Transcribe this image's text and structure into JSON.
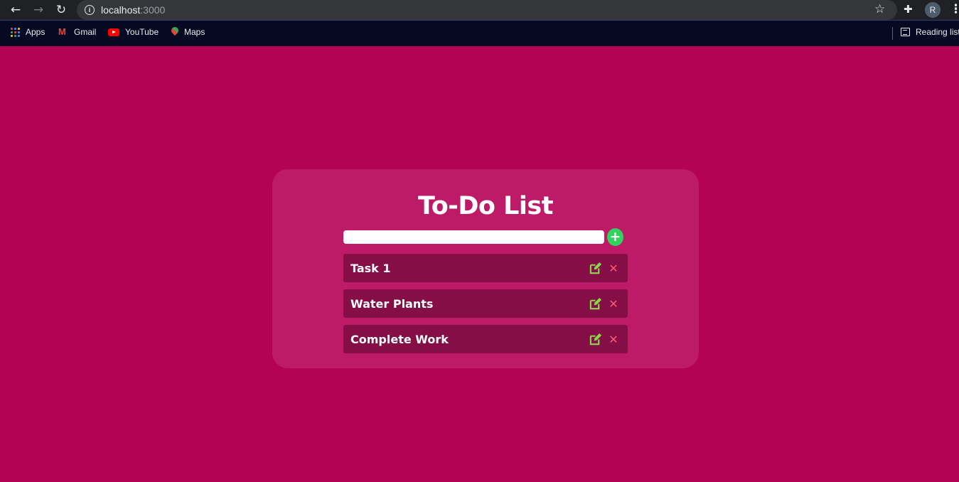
{
  "browser": {
    "back_icon": "arrow-left-icon",
    "forward_icon": "arrow-right-icon",
    "reload_icon": "reload-icon",
    "url_host": "localhost",
    "url_port": ":3000",
    "avatar_letter": "R"
  },
  "bookmarks": [
    {
      "label": "Apps",
      "icon": "apps-grid-icon"
    },
    {
      "label": "Gmail",
      "icon": "gmail-icon"
    },
    {
      "label": "YouTube",
      "icon": "youtube-icon"
    },
    {
      "label": "Maps",
      "icon": "maps-icon"
    }
  ],
  "reading_list": {
    "label": "Reading list",
    "icon": "reading-list-icon"
  },
  "app": {
    "title": "To-Do List",
    "input_value": "",
    "add_label": "+",
    "tasks": [
      {
        "text": "Task 1"
      },
      {
        "text": "Water Plants"
      },
      {
        "text": "Complete Work"
      }
    ],
    "delete_label": "✕",
    "colors": {
      "page_background": "#b40256",
      "card_background": "#bd1a68",
      "task_background": "#860e47",
      "add_button": "#30d35e",
      "edit_icon": "#8bd94a",
      "delete_icon": "#ff5a6e"
    }
  }
}
